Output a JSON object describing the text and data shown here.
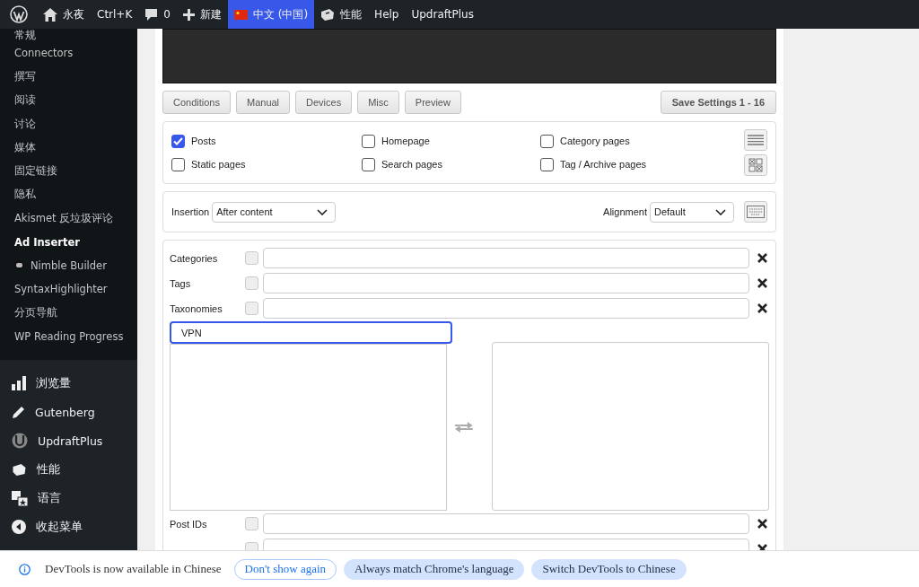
{
  "admin_bar": {
    "items": [
      {
        "kind": "logo",
        "selected": false
      },
      {
        "kind": "home",
        "label": "永夜",
        "selected": false
      },
      {
        "kind": "text",
        "label": "Ctrl+K",
        "selected": false
      },
      {
        "kind": "comments",
        "label": "0",
        "selected": false
      },
      {
        "kind": "new",
        "label": "新建",
        "selected": false
      },
      {
        "kind": "language",
        "label": "中文 (中国)",
        "selected": true
      },
      {
        "kind": "performance",
        "label": "性能",
        "selected": false
      },
      {
        "kind": "text",
        "label": "Help",
        "selected": false
      },
      {
        "kind": "text",
        "label": "UpdraftPlus",
        "selected": false
      }
    ]
  },
  "sidebar": {
    "submenu": [
      {
        "label": "常规",
        "selected": false
      },
      {
        "label": "Connectors",
        "selected": false
      },
      {
        "label": "撰写",
        "selected": false
      },
      {
        "label": "阅读",
        "selected": false
      },
      {
        "label": "讨论",
        "selected": false
      },
      {
        "label": "媒体",
        "selected": false
      },
      {
        "label": "固定链接",
        "selected": false
      },
      {
        "label": "隐私",
        "selected": false
      },
      {
        "label": "Akismet 反垃圾评论",
        "selected": false
      },
      {
        "label": "Ad Inserter",
        "selected": true
      },
      {
        "label": "Nimble Builder",
        "selected": false,
        "kind": "nimble"
      },
      {
        "label": "SyntaxHighlighter",
        "selected": false
      },
      {
        "label": "分页导航",
        "selected": false
      },
      {
        "label": "WP Reading Progress",
        "selected": false
      }
    ],
    "menu": [
      {
        "kind": "stats",
        "label": "浏览量"
      },
      {
        "kind": "pencil",
        "label": "Gutenberg"
      },
      {
        "kind": "updraft",
        "label": "UpdraftPlus"
      },
      {
        "kind": "performance",
        "label": "性能"
      },
      {
        "kind": "translate",
        "label": "语言"
      },
      {
        "kind": "collapse",
        "label": "收起菜单"
      }
    ]
  },
  "tabs": [
    "Conditions",
    "Manual",
    "Devices",
    "Misc",
    "Preview"
  ],
  "save_button": "Save Settings 1 - 16",
  "page_types": [
    {
      "label": "Posts",
      "checked": true
    },
    {
      "label": "Homepage",
      "checked": false
    },
    {
      "label": "Category pages",
      "checked": false
    },
    {
      "label": "Static pages",
      "checked": false
    },
    {
      "label": "Search pages",
      "checked": false
    },
    {
      "label": "Tag / Archive pages",
      "checked": false
    }
  ],
  "insertion": {
    "label": "Insertion",
    "value": "After content"
  },
  "alignment": {
    "label": "Alignment",
    "value": "Default"
  },
  "filters_top": [
    {
      "label": "Categories",
      "checked": false
    },
    {
      "label": "Tags",
      "checked": false
    },
    {
      "label": "Taxonomies",
      "checked": false
    }
  ],
  "search": {
    "value": "VPN"
  },
  "filters_bottom": [
    {
      "label": "Post IDs",
      "checked": false
    },
    {
      "checked": false
    }
  ],
  "devtools_bar": {
    "message": "DevTools is now available in Chinese",
    "buttons": [
      {
        "label": "Don't show again",
        "kind": "outline"
      },
      {
        "label": "Always match Chrome's language",
        "kind": "filled"
      },
      {
        "label": "Switch DevTools to Chinese",
        "kind": "filled"
      }
    ]
  }
}
